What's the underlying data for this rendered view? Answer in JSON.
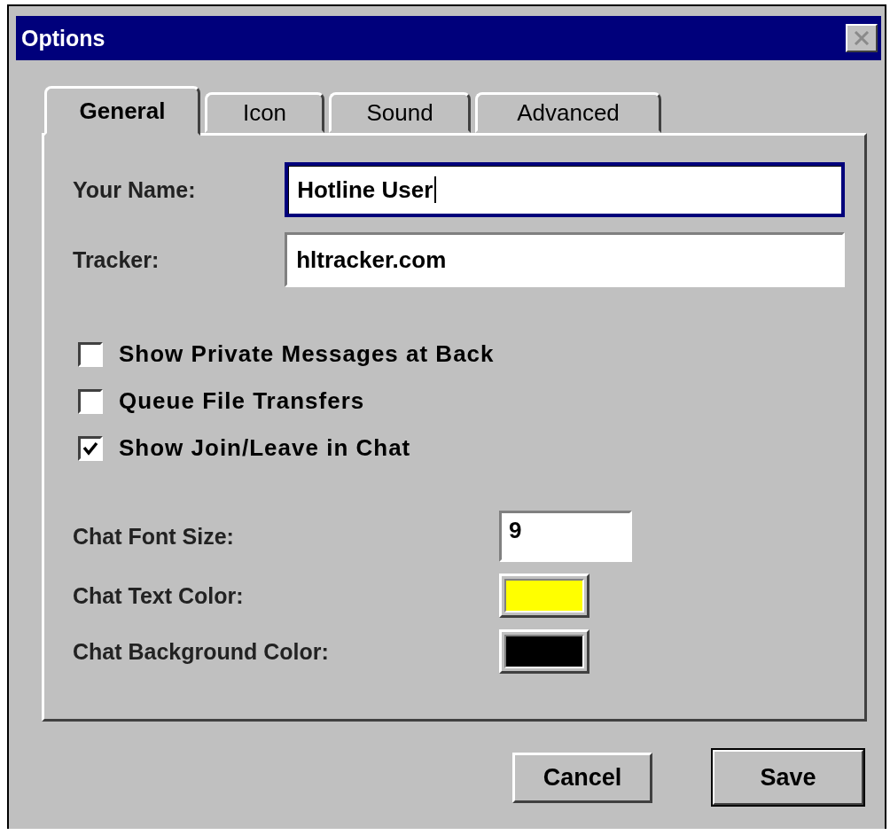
{
  "window": {
    "title": "Options",
    "close_disabled": true
  },
  "tabs": [
    {
      "label": "General",
      "selected": true
    },
    {
      "label": "Icon",
      "selected": false
    },
    {
      "label": "Sound",
      "selected": false
    },
    {
      "label": "Advanced",
      "selected": false
    }
  ],
  "fields": [
    {
      "label": "Your Name:",
      "value": "Hotline User",
      "focused": true
    },
    {
      "label": "Tracker:",
      "value": "hltracker.com",
      "focused": false
    }
  ],
  "checkboxes": [
    {
      "label": "Show Private Messages at Back",
      "checked": false
    },
    {
      "label": "Queue File Transfers",
      "checked": false
    },
    {
      "label": "Show Join/Leave in Chat",
      "checked": true
    }
  ],
  "font_size": {
    "label": "Chat Font Size:",
    "value": "9"
  },
  "colors": [
    {
      "label": "Chat Text Color:",
      "color": "#ffff00"
    },
    {
      "label": "Chat Background Color:",
      "color": "#000000"
    }
  ],
  "buttons": [
    {
      "label": "Cancel",
      "default": false
    },
    {
      "label": "Save",
      "default": true
    }
  ]
}
